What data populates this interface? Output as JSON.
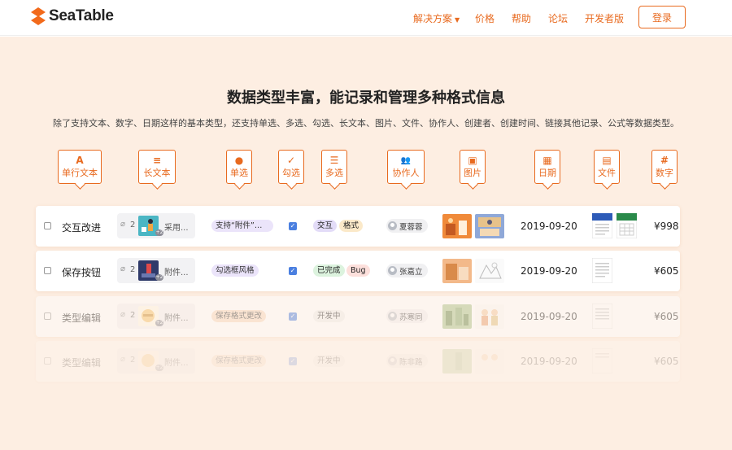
{
  "header": {
    "logo_text": "SeaTable",
    "nav": [
      "解决方案",
      "价格",
      "帮助",
      "论坛",
      "开发者版"
    ],
    "login_label": "登录"
  },
  "hero": {
    "title": "数据类型丰富，能记录和管理多种格式信息",
    "subtitle": "除了支持文本、数字、日期这样的基本类型，还支持单选、多选、勾选、长文本、图片、文件、协作人、创建者、创建时间、链接其他记录、公式等数据类型。"
  },
  "types": [
    {
      "icon": "A",
      "label": "单行文本"
    },
    {
      "icon": "≡",
      "label": "长文本"
    },
    {
      "icon": "●",
      "label": "单选"
    },
    {
      "icon": "✓",
      "label": "勾选"
    },
    {
      "icon": "☰",
      "label": "多选"
    },
    {
      "icon": "👥",
      "label": "协作人"
    },
    {
      "icon": "▣",
      "label": "图片"
    },
    {
      "icon": "▦",
      "label": "日期"
    },
    {
      "icon": "▤",
      "label": "文件"
    },
    {
      "icon": "#",
      "label": "数字"
    }
  ],
  "rows": [
    {
      "title": "交互改进",
      "attach_count": "2",
      "attach_more": "+2",
      "attach_name": "采用...",
      "long_text": "支持“附件”类...",
      "checked": true,
      "multi": [
        {
          "text": "交互",
          "color": "#e3dcf8"
        },
        {
          "text": "格式",
          "color": "#fbe9c9"
        }
      ],
      "user": "夏蓉蓉",
      "date": "2019-09-20",
      "number": "¥998"
    },
    {
      "title": "保存按钮",
      "attach_count": "2",
      "attach_more": "+2",
      "attach_name": "附件...",
      "long_text": "勾选框风格",
      "checked": true,
      "multi": [
        {
          "text": "已完成",
          "color": "#dcf3de"
        },
        {
          "text": "Bug",
          "color": "#fde0dc"
        }
      ],
      "user": "张嘉立",
      "date": "2019-09-20",
      "number": "¥605"
    },
    {
      "title": "类型编辑",
      "attach_count": "2",
      "attach_more": "+2",
      "attach_name": "附件...",
      "long_text": "保存格式更改",
      "checked": true,
      "multi": [
        {
          "text": "开发中",
          "color": "#eeeeee"
        }
      ],
      "user": "苏寒同",
      "date": "2019-09-20",
      "number": "¥605"
    },
    {
      "title": "类型编辑",
      "attach_count": "2",
      "attach_more": "+2",
      "attach_name": "附件...",
      "long_text": "保存格式更改",
      "checked": true,
      "multi": [
        {
          "text": "开发中",
          "color": "#eeeeee"
        }
      ],
      "user": "陈非路",
      "date": "2019-09-20",
      "number": "¥605"
    }
  ],
  "colors": {
    "accent": "#e86a1f",
    "hero_bg": "#fdeee2"
  }
}
